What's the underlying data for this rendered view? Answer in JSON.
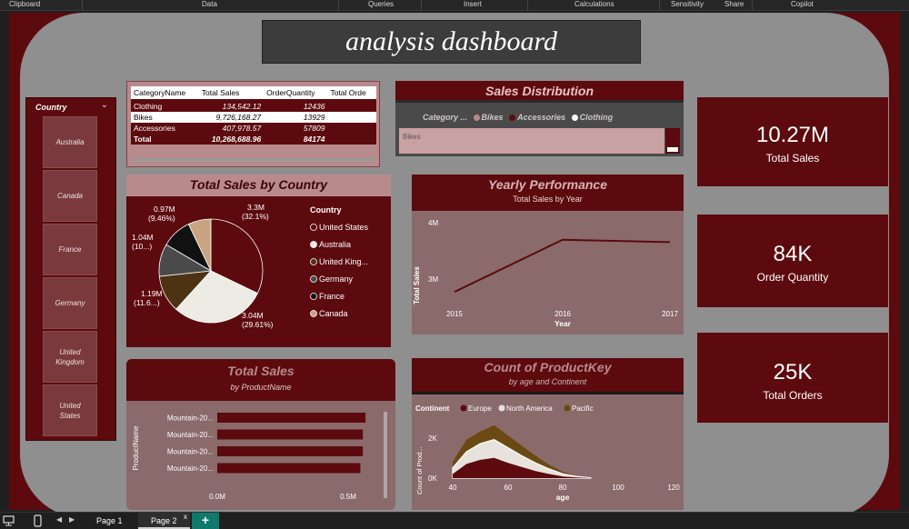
{
  "ribbon": {
    "items": [
      "Clipboard",
      "Data",
      "Queries",
      "Insert",
      "Calculations",
      "Sensitivity",
      "Share",
      "Copilot"
    ]
  },
  "dashboard": {
    "title": "analysis dashboard"
  },
  "slicer": {
    "title": "Country",
    "items": [
      "Australia",
      "Canada",
      "France",
      "Germany",
      "United Kingdom",
      "United States"
    ]
  },
  "table": {
    "columns": [
      "CategoryName",
      "Total Sales",
      "OrderQuantity",
      "Total Orde"
    ],
    "rows": [
      {
        "name": "Clothing",
        "sales": "134,542.12",
        "qty": "12436"
      },
      {
        "name": "Bikes",
        "sales": "9,726,168.27",
        "qty": "13929"
      },
      {
        "name": "Accessories",
        "sales": "407,978.57",
        "qty": "57809"
      }
    ],
    "total": {
      "name": "Total",
      "sales": "10,268,688.96",
      "qty": "84174"
    }
  },
  "sales_distribution": {
    "title": "Sales Distribution",
    "legend_title": "Category ...",
    "legend": [
      {
        "name": "Bikes",
        "color": "#b98a8c"
      },
      {
        "name": "Accessories",
        "color": "#5c0a0e"
      },
      {
        "name": "Clothing",
        "color": "#ffffff"
      }
    ],
    "bar_label": "Bikes"
  },
  "kpis": [
    {
      "value": "10.27M",
      "label": "Total Sales"
    },
    {
      "value": "84K",
      "label": "Order Quantity"
    },
    {
      "value": "25K",
      "label": "Total Orders"
    }
  ],
  "pie": {
    "title": "Total Sales by Country",
    "legend_title": "Country",
    "legend": [
      "United States",
      "Australia",
      "United King...",
      "Germany",
      "France",
      "Canada"
    ],
    "labels": [
      {
        "l1": "3.3M",
        "l2": "(32.1%)"
      },
      {
        "l1": "3.04M",
        "l2": "(29.61%)"
      },
      {
        "l1": "1.19M",
        "l2": "(11.6...)"
      },
      {
        "l1": "1.04M",
        "l2": "(10...)"
      },
      {
        "l1": "0.97M",
        "l2": "(9.46%)"
      }
    ]
  },
  "yearly": {
    "title": "Yearly Performance",
    "subtitle": "Total Sales by Year",
    "ylabel": "Total Sales",
    "xlabel": "Year",
    "yticks": [
      "4M",
      "3M"
    ],
    "xticks": [
      "2015",
      "2016",
      "2017"
    ]
  },
  "total_sales": {
    "title": "Total Sales",
    "subtitle": "by ProductName",
    "ylabel": "ProductName",
    "categories": [
      "Mountain-20...",
      "Mountain-20...",
      "Mountain-20...",
      "Mountain-20..."
    ],
    "xticks": [
      "0.0M",
      "0.5M"
    ]
  },
  "count_product": {
    "title": "Count of ProductKey",
    "subtitle": "by age and Continent",
    "legend_title": "Continent",
    "legend": [
      "Europe",
      "North America",
      "Pacific"
    ],
    "ylabel": "Count of Prod...",
    "xlabel": "age",
    "yticks": [
      "2K",
      "0K"
    ],
    "xticks": [
      "40",
      "60",
      "80",
      "100",
      "120"
    ]
  },
  "tabs": [
    "Page 1",
    "Page 2"
  ],
  "chart_data": [
    {
      "type": "pie",
      "title": "Total Sales by Country",
      "categories": [
        "United States",
        "Australia",
        "United Kingdom",
        "Germany",
        "France",
        "Canada"
      ],
      "values": [
        3.3,
        3.04,
        1.19,
        1.04,
        0.97,
        0.73
      ],
      "percent": [
        32.1,
        29.61,
        11.6,
        10.1,
        9.46,
        7.1
      ],
      "colors": [
        "#5c0a0e",
        "#ecebe4",
        "#4d3311",
        "#4a4a4a",
        "#111111",
        "#c8a482"
      ]
    },
    {
      "type": "line",
      "title": "Yearly Performance",
      "x": [
        2015,
        2016,
        2017
      ],
      "values": [
        2.8,
        3.85,
        3.8
      ],
      "ylim": [
        2.6,
        4.1
      ]
    },
    {
      "type": "bar",
      "title": "Total Sales",
      "categories": [
        "Mountain-20...",
        "Mountain-20...",
        "Mountain-20...",
        "Mountain-20..."
      ],
      "values": [
        0.57,
        0.56,
        0.56,
        0.55
      ],
      "xlim": [
        0,
        0.65
      ]
    },
    {
      "type": "area",
      "title": "Count of ProductKey",
      "x": [
        40,
        45,
        50,
        55,
        60,
        65,
        70,
        75,
        80,
        85,
        90
      ],
      "series": [
        {
          "name": "Europe",
          "values": [
            200,
            700,
            900,
            1000,
            750,
            550,
            350,
            200,
            80,
            30,
            5
          ]
        },
        {
          "name": "North America",
          "values": [
            500,
            1300,
            1700,
            1900,
            1500,
            1100,
            750,
            450,
            200,
            80,
            20
          ]
        },
        {
          "name": "Pacific",
          "values": [
            800,
            1900,
            2300,
            2600,
            2100,
            1600,
            1100,
            650,
            300,
            110,
            30
          ]
        }
      ],
      "ylim": [
        0,
        3000
      ]
    }
  ]
}
